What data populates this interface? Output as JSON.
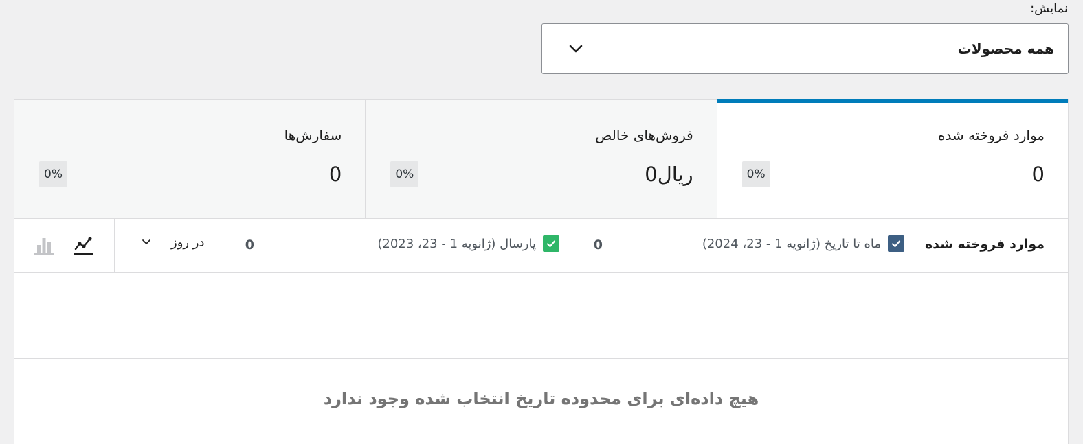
{
  "filter": {
    "label": "نمایش:",
    "selected": "همه محصولات"
  },
  "cards": [
    {
      "label": "موارد فروخته شده",
      "value": "0",
      "delta": "0%",
      "active": true
    },
    {
      "label": "فروش‌های خالص",
      "value": "ریال0",
      "delta": "0%",
      "active": false
    },
    {
      "label": "سفارش‌ها",
      "value": "0",
      "delta": "0%",
      "active": false
    }
  ],
  "chart": {
    "title": "موارد فروخته شده",
    "legend": [
      {
        "label": "ماه تا تاریخ (ژانویه 1 - 23، 2024)",
        "total": "0",
        "color": "#3d5f83",
        "checked": true
      },
      {
        "label": "پارسال (ژانویه 1 - 23، 2023)",
        "total": "0",
        "color": "#2fb668",
        "checked": true
      }
    ],
    "interval": "در روز",
    "tools": {
      "line_icon": "line-chart-icon",
      "bar_icon": "bar-chart-icon",
      "active": "line"
    },
    "empty_message": "هیچ داده‌ای برای محدوده تاریخ انتخاب شده وجود ندارد"
  },
  "colors": {
    "accent": "#007cba",
    "current_series": "#3d5f83",
    "previous_series": "#2fb668"
  }
}
